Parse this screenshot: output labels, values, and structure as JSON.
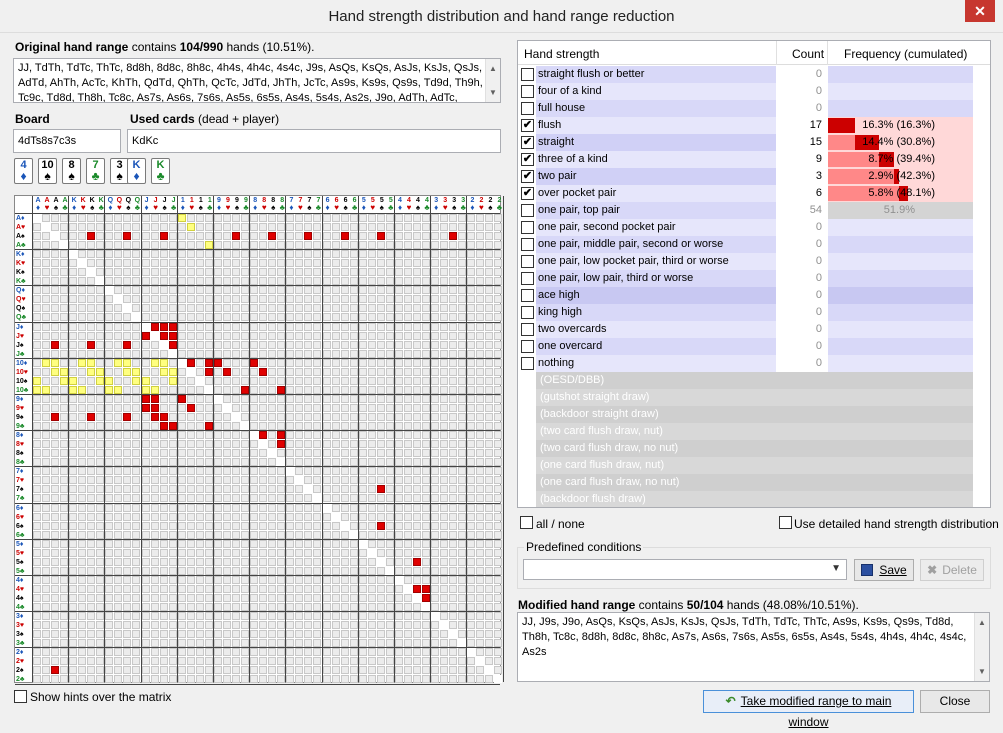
{
  "window": {
    "title": "Hand strength distribution and hand range reduction",
    "close_symbol": "✕"
  },
  "original": {
    "label_bold": "Original hand range",
    "label_mid": " contains ",
    "count": "104/990",
    "label_tail": " hands (10.51%).",
    "text": "JJ, TdTh, TdTc, ThTc, 8d8h, 8d8c, 8h8c, 4h4s, 4h4c, 4s4c, J9s, AsQs, KsQs, AsJs, KsJs, QsJs, AdTd, AhTh, AcTc, KhTh, QdTd, QhTh, QcTc, JdTd, JhTh, JcTc, As9s, Ks9s, Qs9s, Td9d, Th9h, Tc9c, Td8d, Th8h, Tc8c, As7s, As6s, 7s6s, As5s, 6s5s, As4s, 5s4s, As2s, J9o, AdTh, AdTc,"
  },
  "board": {
    "label": "Board",
    "value": "4dTs8s7c3s"
  },
  "used": {
    "label_bold": "Used cards",
    "label_tail": " (dead + player)",
    "value": "KdKc"
  },
  "board_cards": [
    {
      "rank": "4",
      "suit": "♦",
      "color": "#1a55b8"
    },
    {
      "rank": "10",
      "suit": "♠",
      "color": "#000000"
    },
    {
      "rank": "8",
      "suit": "♠",
      "color": "#000000"
    },
    {
      "rank": "7",
      "suit": "♣",
      "color": "#1a8a2a"
    },
    {
      "rank": "3",
      "suit": "♠",
      "color": "#000000"
    }
  ],
  "used_cards": [
    {
      "rank": "K",
      "suit": "♦",
      "color": "#1a55b8"
    },
    {
      "rank": "K",
      "suit": "♣",
      "color": "#1a8a2a"
    }
  ],
  "matrix": {
    "ranks": [
      "A",
      "K",
      "Q",
      "J",
      "10",
      "9",
      "8",
      "7",
      "6",
      "5",
      "4",
      "3",
      "2"
    ],
    "suits": [
      "♦",
      "♥",
      "♠",
      "♣"
    ],
    "suit_colors": [
      "#1a55b8",
      "#cc0000",
      "#000000",
      "#1a8a2a"
    ],
    "red": "#e00000",
    "yellow": "#ffff80"
  },
  "table": {
    "col_strength": "Hand strength",
    "col_count": "Count",
    "col_freq": "Frequency (cumulated)",
    "rows": [
      {
        "label": "straight flush or better",
        "count": "0",
        "checked": false,
        "freq": "",
        "bar": 0,
        "bg": "#d8d8f8"
      },
      {
        "label": "four of a kind",
        "count": "0",
        "checked": false,
        "freq": "",
        "bar": 0,
        "bg": "#e6e6fb"
      },
      {
        "label": "full house",
        "count": "0",
        "checked": false,
        "freq": "",
        "bar": 0,
        "bg": "#d8d8f8"
      },
      {
        "label": "flush",
        "count": "17",
        "checked": true,
        "freq": "16.3% (16.3%)",
        "bar": 16.3,
        "bg": "#e6e6fb"
      },
      {
        "label": "straight",
        "count": "15",
        "checked": true,
        "freq": "14.4% (30.8%)",
        "bar": 14.4,
        "bg": "#d0d0f6"
      },
      {
        "label": "three of a kind",
        "count": "9",
        "checked": true,
        "freq": "8.7% (39.4%)",
        "bar": 8.7,
        "bg": "#e6e6fb"
      },
      {
        "label": "two pair",
        "count": "3",
        "checked": true,
        "freq": "2.9% (42.3%)",
        "bar": 2.9,
        "bg": "#d0d0f6"
      },
      {
        "label": "over pocket pair",
        "count": "6",
        "checked": true,
        "freq": "5.8% (48.1%)",
        "bar": 5.8,
        "bg": "#e6e6fb"
      },
      {
        "label": "one pair, top pair",
        "count": "54",
        "checked": false,
        "freq": "51.9%",
        "bar": 0,
        "bg": "#d8d8f8",
        "gray": true
      },
      {
        "label": "one pair, second pocket pair",
        "count": "0",
        "checked": false,
        "freq": "",
        "bar": 0,
        "bg": "#e6e6fb"
      },
      {
        "label": "one pair, middle pair, second or worse",
        "count": "0",
        "checked": false,
        "freq": "",
        "bar": 0,
        "bg": "#d8d8f8"
      },
      {
        "label": "one pair, low pocket pair, third or worse",
        "count": "0",
        "checked": false,
        "freq": "",
        "bar": 0,
        "bg": "#e6e6fb"
      },
      {
        "label": "one pair, low pair, third or worse",
        "count": "0",
        "checked": false,
        "freq": "",
        "bar": 0,
        "bg": "#d8d8f8"
      },
      {
        "label": "ace high",
        "count": "0",
        "checked": false,
        "freq": "",
        "bar": 0,
        "bg": "#c8c8f2"
      },
      {
        "label": "king high",
        "count": "0",
        "checked": false,
        "freq": "",
        "bar": 0,
        "bg": "#d8d8f8"
      },
      {
        "label": "two overcards",
        "count": "0",
        "checked": false,
        "freq": "",
        "bar": 0,
        "bg": "#e6e6fb"
      },
      {
        "label": "one overcard",
        "count": "0",
        "checked": false,
        "freq": "",
        "bar": 0,
        "bg": "#d8d8f8"
      },
      {
        "label": "nothing",
        "count": "0",
        "checked": false,
        "freq": "",
        "bar": 0,
        "bg": "#e6e6fb"
      }
    ],
    "draws": [
      "(OESD/DBB)",
      "(gutshot straight draw)",
      "(backdoor straight draw)",
      "(two card flush draw, nut)",
      "(two card flush draw, no nut)",
      "(one card flush draw, nut)",
      "(one card flush draw, no nut)",
      "(backdoor flush draw)"
    ]
  },
  "controls": {
    "all_none": "all / none",
    "detailed": "Use detailed hand strength distribution",
    "predef_label": "Predefined conditions",
    "save": "Save",
    "delete": "Delete",
    "show_hints": "Show hints over the matrix"
  },
  "modified": {
    "label_bold": "Modified hand range",
    "label_mid": " contains ",
    "count": "50/104",
    "label_tail": " hands (48.08%/10.51%).",
    "text": "JJ, J9s, J9o, AsQs, KsQs, AsJs, KsJs, QsJs, TdTh, TdTc, ThTc, As9s, Ks9s, Qs9s, Td8d, Th8h, Tc8c, 8d8h, 8d8c, 8h8c, As7s, As6s, 7s6s, As5s, 6s5s, As4s, 5s4s, 4h4s, 4h4c, 4s4c, As2s"
  },
  "buttons": {
    "take": "Take modified range to main window",
    "close": "Close"
  },
  "colors": {
    "bar_dark": "#cc0000",
    "bar_light": "#ff8888",
    "bar_bg": "#ffd8d8"
  }
}
